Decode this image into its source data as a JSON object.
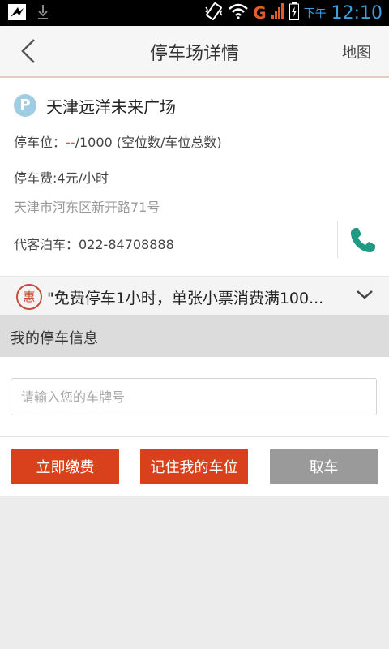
{
  "status_bar": {
    "ampm": "下午",
    "time": "12:10",
    "network": "G",
    "icons": [
      "app-icon",
      "download-icon",
      "vibrate-icon",
      "wifi-icon",
      "signal-icon",
      "battery-charging-icon"
    ]
  },
  "header": {
    "title": "停车场详情",
    "map_label": "地图",
    "back_icon": "chevron-left-icon"
  },
  "lot": {
    "badge": "P",
    "name": "天津远洋未来广场",
    "spots_label": "停车位：",
    "spots_free": "--",
    "spots_total": "/1000",
    "spots_note": "(空位数/车位总数)",
    "fee": "停车费:4元/小时",
    "address": "天津市河东区新开路71号",
    "valet_label": "代客泊车：",
    "valet_phone": "022-84708888"
  },
  "promo": {
    "badge": "惠",
    "text": "\"免费停车1小时，单张小票消费满100..."
  },
  "my_parking": {
    "title": "我的停车信息",
    "plate_placeholder": "请输入您的车牌号",
    "plate_value": ""
  },
  "actions": {
    "pay": "立即缴费",
    "remember": "记住我的车位",
    "pickup": "取车"
  },
  "colors": {
    "accent": "#d9411d",
    "disabled": "#9a9a9a",
    "phone_green": "#1f9a84",
    "badge_blue": "#9ecde4",
    "clock_blue": "#3aa0e0"
  }
}
